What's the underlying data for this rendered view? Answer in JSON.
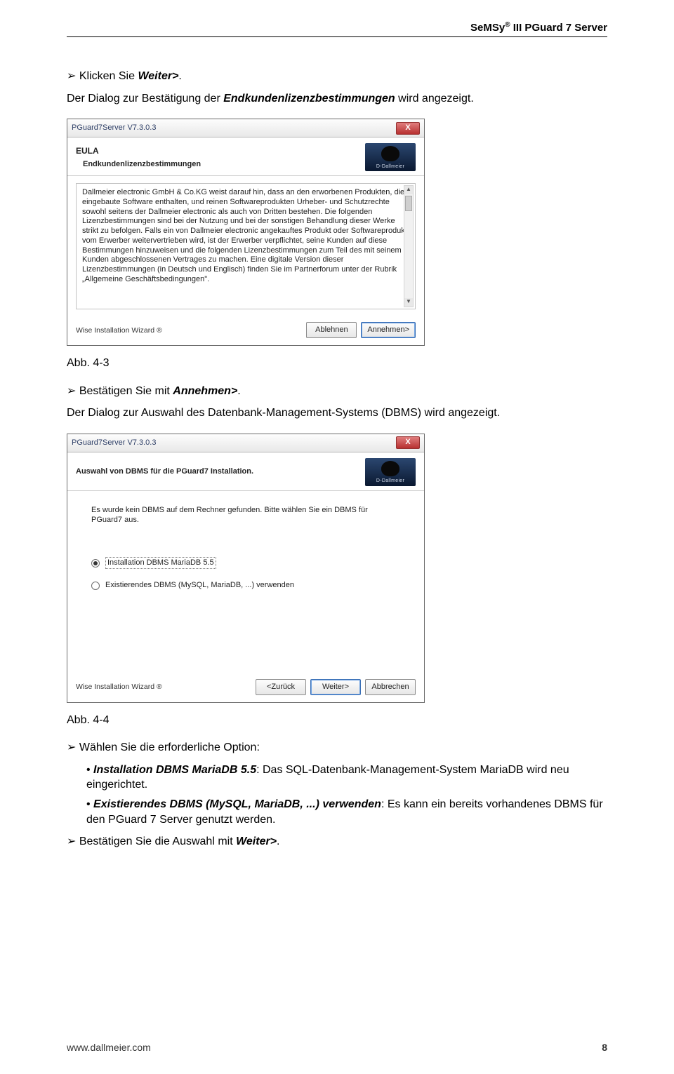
{
  "header": {
    "product": "SeMSy",
    "reg": "®",
    "suffix": "III PGuard 7 Server"
  },
  "lines": {
    "l1a": "Klicken Sie ",
    "l1b": "Weiter>",
    "l1c": ".",
    "l2a": "Der Dialog zur Bestätigung der ",
    "l2b": "Endkundenlizenzbestimmungen",
    "l2c": " wird angezeigt.",
    "cap1": "Abb. 4-3",
    "l3a": "Bestätigen Sie mit ",
    "l3b": "Annehmen>",
    "l3c": ".",
    "l4": "Der Dialog zur Auswahl des Datenbank-Management-Systems (DBMS) wird angezeigt.",
    "cap2": "Abb. 4-4",
    "l5": "Wählen Sie die erforderliche Option:",
    "s1a": "Installation DBMS MariaDB 5.5",
    "s1b": ": Das SQL-Datenbank-Management-System MariaDB wird neu eingerichtet.",
    "s2a": "Existierendes DBMS (MySQL, MariaDB, ...) verwenden",
    "s2b": ": Es kann ein bereits vorhandenes DBMS für den PGuard 7 Server genutzt werden.",
    "l6a": "Bestätigen Sie die Auswahl mit ",
    "l6b": "Weiter>",
    "l6c": "."
  },
  "dialog_eula": {
    "title": "PGuard7Server V7.3.0.3",
    "close": "X",
    "h1": "EULA",
    "h2": "Endkundenlizenzbestimmungen",
    "logo_text": "D-Dallmeier",
    "text": "Dallmeier electronic GmbH & Co.KG weist darauf hin, dass an den erworbenen Produkten, die eingebaute Software enthalten, und reinen Softwareprodukten Urheber- und Schutzrechte sowohl seitens der Dallmeier electronic als auch von Dritten bestehen. Die folgenden Lizenzbestimmungen sind bei der Nutzung und bei der sonstigen Behandlung dieser Werke strikt zu befolgen. Falls ein von Dallmeier electronic angekauftes Produkt oder Softwareprodukt vom Erwerber weitervertrieben wird, ist der Erwerber verpflichtet, seine Kunden auf diese Bestimmungen hinzuweisen und die folgenden Lizenzbestimmungen zum Teil des mit seinem Kunden abgeschlossenen Vertrages zu machen.\nEine digitale Version dieser Lizenzbestimmungen (in Deutsch und Englisch) finden Sie im Partnerforum unter der Rubrik „Allgemeine Geschäftsbedingungen\".",
    "wizard": "Wise Installation Wizard ®",
    "btn_decline": "Ablehnen",
    "btn_accept": "Annehmen>"
  },
  "dialog_dbms": {
    "title": "PGuard7Server V7.3.0.3",
    "close": "X",
    "h2": "Auswahl von DBMS für die PGuard7 Installation.",
    "logo_text": "D-Dallmeier",
    "msg": "Es wurde kein DBMS auf dem Rechner gefunden. Bitte wählen Sie ein DBMS für PGuard7 aus.",
    "opt1": "Installation DBMS MariaDB 5.5",
    "opt2": "Existierendes DBMS (MySQL, MariaDB, ...) verwenden",
    "wizard": "Wise Installation Wizard ®",
    "btn_back": "<Zurück",
    "btn_next": "Weiter>",
    "btn_cancel": "Abbrechen"
  },
  "footer": {
    "url": "www.dallmeier.com",
    "page": "8"
  }
}
